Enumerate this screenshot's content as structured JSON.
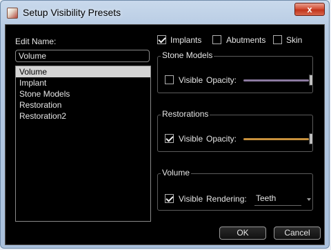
{
  "window": {
    "title": "Setup Visibility Presets",
    "close_glyph": "x"
  },
  "edit_name": {
    "label": "Edit Name:",
    "value": "Volume"
  },
  "presets": {
    "items": [
      "Volume",
      "Implant",
      "Stone Models",
      "Restoration",
      "Restoration2"
    ],
    "selected": "Volume"
  },
  "filters": {
    "implants": {
      "label": "Implants",
      "checked": true
    },
    "abutments": {
      "label": "Abutments",
      "checked": false
    },
    "skin": {
      "label": "Skin",
      "checked": false
    }
  },
  "stone_models": {
    "title": "Stone Models",
    "visible_label": "Visible",
    "visible_checked": false,
    "opacity_label": "Opacity:",
    "opacity": 1.0,
    "track_color": "#8c7aa0"
  },
  "restorations": {
    "title": "Restorations",
    "visible_label": "Visible",
    "visible_checked": true,
    "opacity_label": "Opacity:",
    "opacity": 1.0,
    "track_color": "#c8913c"
  },
  "volume": {
    "title": "Volume",
    "visible_label": "Visible",
    "visible_checked": true,
    "rendering_label": "Rendering:",
    "rendering_value": "Teeth"
  },
  "buttons": {
    "ok": "OK",
    "cancel": "Cancel"
  }
}
